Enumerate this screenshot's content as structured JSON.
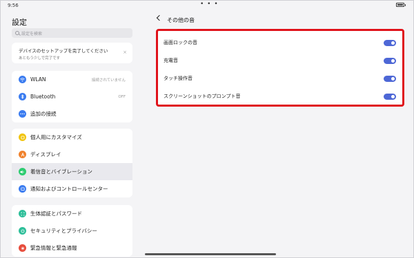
{
  "status": {
    "time": "9:56",
    "dots": "• • •"
  },
  "left": {
    "title": "設定",
    "search_placeholder": "設定を検索",
    "setup": {
      "title": "デバイスのセットアップを完了してください",
      "subtitle": "あともう少しで完了です",
      "close": "×"
    },
    "network": [
      {
        "label": "WLAN",
        "value": "接続されていません",
        "icon": "wifi-icon",
        "color": "#3b7cf0"
      },
      {
        "label": "Bluetooth",
        "value": "OFF",
        "icon": "bluetooth-icon",
        "color": "#3b7cf0"
      },
      {
        "label": "追加の接続",
        "value": "",
        "icon": "more-icon",
        "color": "#3b7cf0"
      }
    ],
    "display": [
      {
        "label": "個人用にカスタマイズ",
        "icon": "personalize-icon",
        "color": "#f1c40f"
      },
      {
        "label": "ディスプレイ",
        "icon": "display-icon",
        "color": "#f0822d"
      },
      {
        "label": "着信音とバイブレーション",
        "icon": "sound-icon",
        "color": "#2ecc71",
        "active": true
      },
      {
        "label": "通知およびコントロールセンター",
        "icon": "notification-icon",
        "color": "#3b7cf0"
      }
    ],
    "security": [
      {
        "label": "生体認証とパスワード",
        "icon": "biometric-icon",
        "color": "#2fbf9a"
      },
      {
        "label": "セキュリティとプライバシー",
        "icon": "security-icon",
        "color": "#2fbf9a"
      },
      {
        "label": "緊急情報と緊急通報",
        "icon": "emergency-icon",
        "color": "#e74c3c"
      }
    ]
  },
  "right": {
    "title": "その他の音",
    "items": [
      {
        "label": "画面ロックの音",
        "on": true
      },
      {
        "label": "充電音",
        "on": true
      },
      {
        "label": "タッチ操作音",
        "on": true
      },
      {
        "label": "スクリーンショットのプロンプト音",
        "on": true
      }
    ],
    "highlight_color": "#e0121a",
    "toggle_color": "#4d67d6"
  }
}
